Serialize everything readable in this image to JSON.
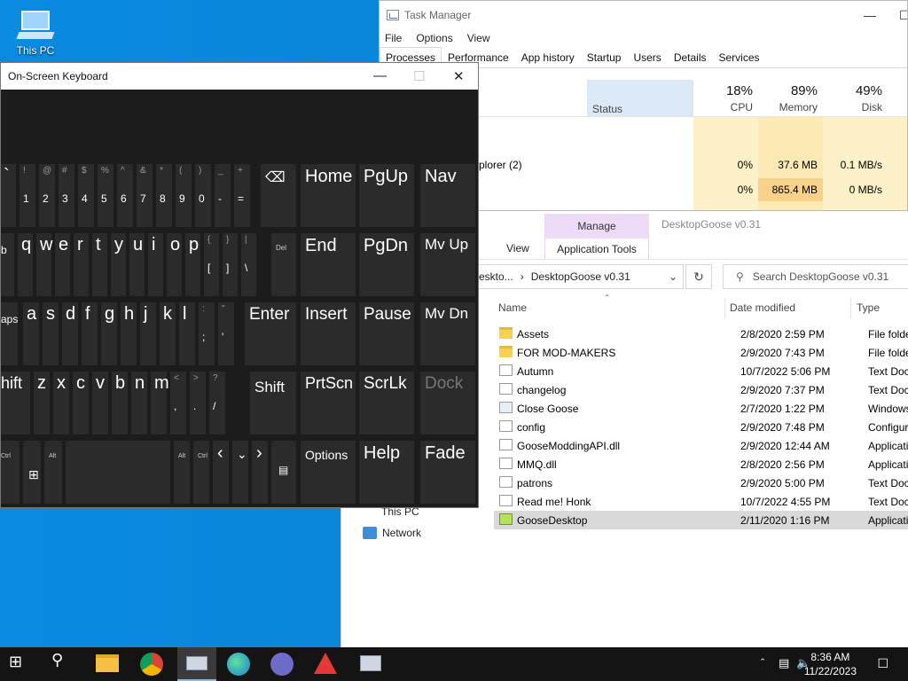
{
  "desktop": {
    "this_pc_label": "This PC"
  },
  "task_manager": {
    "title": "Task Manager",
    "menu": [
      "File",
      "Options",
      "View"
    ],
    "tabs": [
      "Processes",
      "Performance",
      "App history",
      "Startup",
      "Users",
      "Details",
      "Services"
    ],
    "columns": {
      "status": "Status",
      "cpu_pct": "18%",
      "cpu_label": "CPU",
      "mem_pct": "89%",
      "mem_label": "Memory",
      "disk_pct": "49%",
      "disk_label": "Disk"
    },
    "rows": [
      {
        "name": "plorer (2)",
        "cpu": "0%",
        "mem": "37.6 MB",
        "disk": "0.1 MB/s"
      },
      {
        "name": "",
        "cpu": "0%",
        "mem": "865.4 MB",
        "disk": "0 MB/s"
      }
    ]
  },
  "explorer": {
    "manage_label": "Manage",
    "app_tools_label": "Application Tools",
    "title": "DesktopGoose v0.31",
    "view_tab": "View",
    "address_prefix": "eskto...",
    "address_folder": "DesktopGoose v0.31",
    "search_placeholder": "Search DesktopGoose v0.31",
    "headers": {
      "name": "Name",
      "date": "Date modified",
      "type": "Type"
    },
    "files": [
      {
        "name": "Assets",
        "date": "2/8/2020 2:59 PM",
        "type": "File folder",
        "kind": "folder"
      },
      {
        "name": "FOR MOD-MAKERS",
        "date": "2/9/2020 7:43 PM",
        "type": "File folder",
        "kind": "folder"
      },
      {
        "name": "Autumn",
        "date": "10/7/2022 5:06 PM",
        "type": "Text Docum",
        "kind": "doc"
      },
      {
        "name": "changelog",
        "date": "2/9/2020 7:37 PM",
        "type": "Text Docum",
        "kind": "doc"
      },
      {
        "name": "Close Goose",
        "date": "2/7/2020 1:22 PM",
        "type": "Windows B",
        "kind": "app"
      },
      {
        "name": "config",
        "date": "2/9/2020 7:48 PM",
        "type": "Configurat",
        "kind": "doc"
      },
      {
        "name": "GooseModdingAPI.dll",
        "date": "2/9/2020 12:44 AM",
        "type": "Application",
        "kind": "doc"
      },
      {
        "name": "MMQ.dll",
        "date": "2/8/2020 2:56 PM",
        "type": "Application",
        "kind": "doc"
      },
      {
        "name": "patrons",
        "date": "2/9/2020 5:00 PM",
        "type": "Text Docum",
        "kind": "doc"
      },
      {
        "name": "Read me! Honk",
        "date": "10/7/2022 4:55 PM",
        "type": "Text Docum",
        "kind": "doc"
      },
      {
        "name": "GooseDesktop",
        "date": "2/11/2020 1:16 PM",
        "type": "Application",
        "kind": "goose"
      }
    ],
    "nav_partial": "This PC",
    "nav_network": "Network"
  },
  "osk": {
    "title": "On-Screen Keyboard",
    "keys": {
      "home": "Home",
      "pgup": "PgUp",
      "nav": "Nav",
      "end": "End",
      "pgdn": "PgDn",
      "mvup": "Mv Up",
      "enter": "Enter",
      "insert": "Insert",
      "pause": "Pause",
      "mvdn": "Mv Dn",
      "shift_l": "hift",
      "shift_r": "Shift",
      "prtscn": "PrtScn",
      "scrlk": "ScrLk",
      "dock": "Dock",
      "options": "Options",
      "help": "Help",
      "fade": "Fade",
      "caps": "aps",
      "tab": "b",
      "ctrl": "Ctrl",
      "alt": "Alt",
      "del": "Del"
    }
  },
  "taskbar": {
    "time": "8:36 AM",
    "date": "11/22/2023"
  },
  "colors": {
    "desktop": "#0a84d8",
    "taskbar": "#141414",
    "manage_tab": "#eedbf7"
  }
}
